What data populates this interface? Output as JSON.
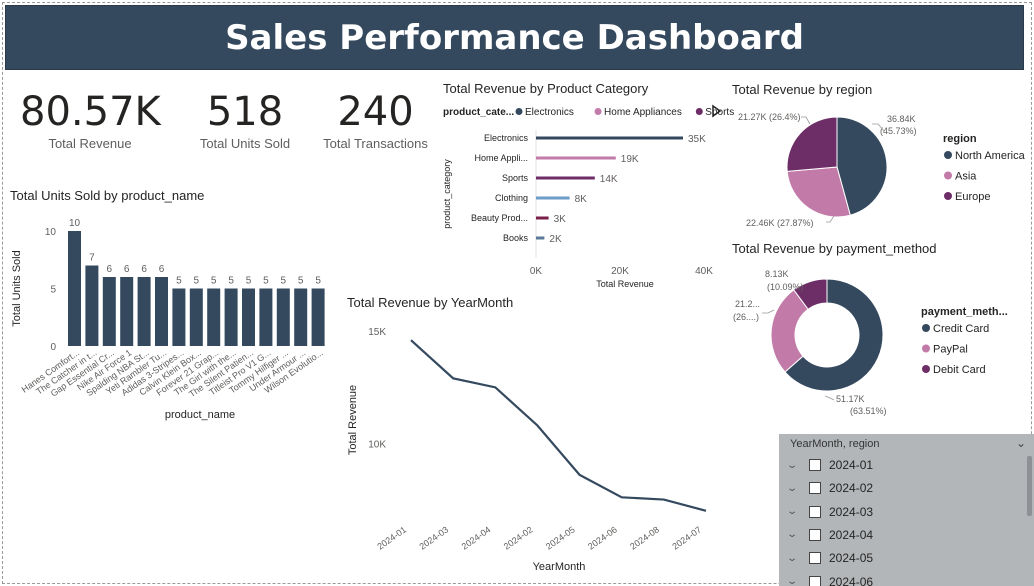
{
  "title": "Sales Performance Dashboard",
  "kpis": [
    {
      "value": "80.57K",
      "label": "Total Revenue"
    },
    {
      "value": "518",
      "label": "Total Units Sold"
    },
    {
      "value": "240",
      "label": "Total Transactions"
    }
  ],
  "colors": {
    "dark": "#34495e",
    "pink": "#c27ba8",
    "purple": "#6d2d66",
    "blue": "#6d9cc9",
    "maroon": "#7a1f4a",
    "slate": "#5b7a99",
    "title_bg": "#34495e"
  },
  "chart_data": [
    {
      "type": "bar",
      "title": "Total Units Sold by product_name",
      "xlabel": "product_name",
      "ylabel": "Total Units Sold",
      "ylim": [
        0,
        10
      ],
      "yticks": [
        "0",
        "5",
        "10"
      ],
      "categories": [
        "Hanes Comfort...",
        "The Catcher in t...",
        "Gap Essential Cr...",
        "Nike Air Force 1",
        "Spalding NBA St...",
        "Yeti Rambler Tu...",
        "Adidas 3-Stripes...",
        "Calvin Klein Box...",
        "Forever 21 Grap...",
        "The Girl with the...",
        "The Silent Patien...",
        "Titleist Pro V1 G...",
        "Tommy Hilfiger ...",
        "Under Armour ...",
        "Wilson Evolutio..."
      ],
      "values": [
        10,
        7,
        6,
        6,
        6,
        6,
        5,
        5,
        5,
        5,
        5,
        5,
        5,
        5,
        5
      ],
      "data_labels": [
        "10",
        "7",
        "6",
        "6",
        "6",
        "6",
        "5",
        "5",
        "5",
        "5",
        "5",
        "5",
        "5",
        "5",
        "5"
      ]
    },
    {
      "type": "bar",
      "orientation": "horizontal",
      "title": "Total Revenue by Product Category",
      "legend_title": "product_cate...",
      "legend": [
        {
          "name": "Electronics",
          "color": "#34495e"
        },
        {
          "name": "Home Appliances",
          "color": "#c27ba8"
        },
        {
          "name": "Sports",
          "color": "#6d2d66"
        }
      ],
      "xlabel": "Total Revenue",
      "ylabel": "product_category",
      "xlim": [
        0,
        40000
      ],
      "xticks": [
        "0K",
        "20K",
        "40K"
      ],
      "categories": [
        "Electronics",
        "Home Appli...",
        "Sports",
        "Clothing",
        "Beauty Prod...",
        "Books"
      ],
      "values": [
        35000,
        19000,
        14000,
        8000,
        3000,
        2000
      ],
      "data_labels": [
        "35K",
        "19K",
        "14K",
        "8K",
        "3K",
        "2K"
      ],
      "colors": [
        "#34495e",
        "#c27ba8",
        "#6d2d66",
        "#6d9cc9",
        "#7a1f4a",
        "#5b7a99"
      ]
    },
    {
      "type": "pie",
      "title": "Total Revenue by region",
      "legend_title": "region",
      "slices": [
        {
          "name": "North America",
          "value": 36840,
          "label": "36.84K",
          "pct": "(45.73%)",
          "color": "#34495e"
        },
        {
          "name": "Asia",
          "value": 22460,
          "label": "22.46K (27.87%)",
          "pct": "",
          "color": "#c27ba8"
        },
        {
          "name": "Europe",
          "value": 21270,
          "label": "21.27K (26.4%)",
          "pct": "",
          "color": "#6d2d66"
        }
      ]
    },
    {
      "type": "pie",
      "donut": true,
      "title": "Total Revenue by payment_method",
      "legend_title": "payment_meth...",
      "slices": [
        {
          "name": "Credit Card",
          "value": 51170,
          "label": "51.17K",
          "pct": "(63.51%)",
          "color": "#34495e"
        },
        {
          "name": "PayPal",
          "value": 21270,
          "label": "21.2...",
          "pct": "(26....)",
          "color": "#c27ba8"
        },
        {
          "name": "Debit Card",
          "value": 8130,
          "label": "8.13K",
          "pct": "(10.09%)",
          "color": "#6d2d66"
        }
      ]
    },
    {
      "type": "line",
      "title": "Total Revenue by YearMonth",
      "xlabel": "YearMonth",
      "ylabel": "Total Revenue",
      "ylim": [
        6500,
        15500
      ],
      "yticks": [
        {
          "v": 15000,
          "t": "15K"
        },
        {
          "v": 10000,
          "t": "10K"
        }
      ],
      "categories": [
        "2024-01",
        "2024-03",
        "2024-04",
        "2024-02",
        "2024-05",
        "2024-06",
        "2024-08",
        "2024-07"
      ],
      "values": [
        14600,
        12900,
        12500,
        10800,
        8600,
        7600,
        7500,
        7000
      ]
    }
  ],
  "slicer": {
    "header": "YearMonth, region",
    "items": [
      "2024-01",
      "2024-02",
      "2024-03",
      "2024-04",
      "2024-05",
      "2024-06"
    ]
  }
}
